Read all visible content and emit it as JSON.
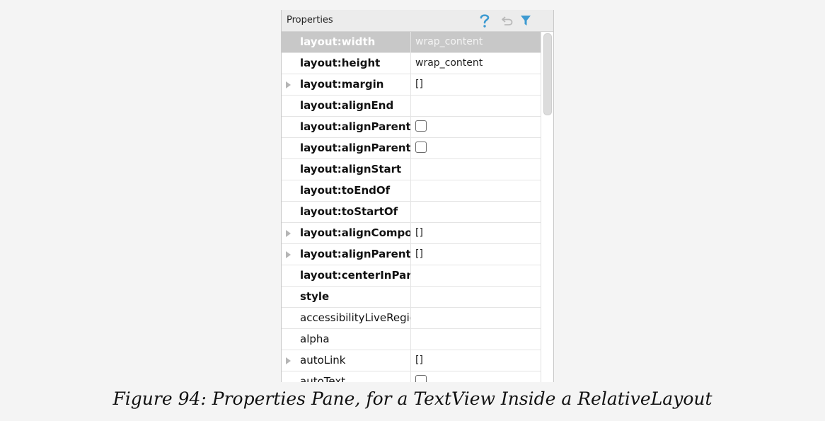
{
  "panel": {
    "title": "Properties",
    "icons": {
      "help": "question-mark-icon",
      "restore": "restore-default-icon",
      "filter": "filter-icon"
    },
    "colors": {
      "accent": "#3d9ad1",
      "selected_row": "#c8c8c8"
    }
  },
  "rows": [
    {
      "name": "layout:width",
      "value": "wrap_content",
      "bold": true,
      "expandable": false,
      "checkbox": false,
      "selected": true
    },
    {
      "name": "layout:height",
      "value": "wrap_content",
      "bold": true,
      "expandable": false,
      "checkbox": false,
      "selected": false
    },
    {
      "name": "layout:margin",
      "value": "[]",
      "bold": true,
      "expandable": true,
      "checkbox": false,
      "selected": false
    },
    {
      "name": "layout:alignEnd",
      "value": "",
      "bold": true,
      "expandable": false,
      "checkbox": false,
      "selected": false
    },
    {
      "name": "layout:alignParent",
      "value": "",
      "bold": true,
      "expandable": false,
      "checkbox": true,
      "selected": false
    },
    {
      "name": "layout:alignParent",
      "value": "",
      "bold": true,
      "expandable": false,
      "checkbox": true,
      "selected": false
    },
    {
      "name": "layout:alignStart",
      "value": "",
      "bold": true,
      "expandable": false,
      "checkbox": false,
      "selected": false
    },
    {
      "name": "layout:toEndOf",
      "value": "",
      "bold": true,
      "expandable": false,
      "checkbox": false,
      "selected": false
    },
    {
      "name": "layout:toStartOf",
      "value": "",
      "bold": true,
      "expandable": false,
      "checkbox": false,
      "selected": false
    },
    {
      "name": "layout:alignCompo",
      "value": "[]",
      "bold": true,
      "expandable": true,
      "checkbox": false,
      "selected": false
    },
    {
      "name": "layout:alignParent",
      "value": "[]",
      "bold": true,
      "expandable": true,
      "checkbox": false,
      "selected": false
    },
    {
      "name": "layout:centerInPar",
      "value": "",
      "bold": true,
      "expandable": false,
      "checkbox": false,
      "selected": false
    },
    {
      "name": "style",
      "value": "",
      "bold": true,
      "expandable": false,
      "checkbox": false,
      "selected": false
    },
    {
      "name": "accessibilityLiveRegio",
      "value": "",
      "bold": false,
      "expandable": false,
      "checkbox": false,
      "selected": false
    },
    {
      "name": "alpha",
      "value": "",
      "bold": false,
      "expandable": false,
      "checkbox": false,
      "selected": false
    },
    {
      "name": "autoLink",
      "value": "[]",
      "bold": false,
      "expandable": true,
      "checkbox": false,
      "selected": false
    },
    {
      "name": "autoText",
      "value": "",
      "bold": false,
      "expandable": false,
      "checkbox": true,
      "selected": false
    }
  ],
  "caption": "Figure 94: Properties Pane, for a TextView Inside a RelativeLayout"
}
